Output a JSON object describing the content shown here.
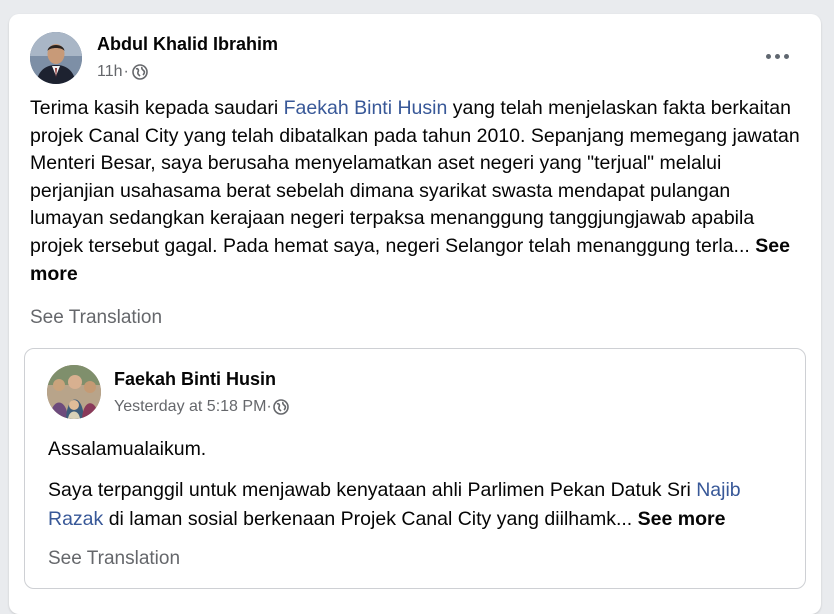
{
  "post": {
    "author": "Abdul Khalid Ibrahim",
    "time": "11h",
    "time_sep": "·",
    "privacy_icon": "globe-icon",
    "more_icon": "more-options-icon",
    "text_before": "Terima kasih kepada saudari ",
    "text_link": "Faekah Binti Husin",
    "text_after": " yang telah menjelaskan fakta berkaitan projek Canal City yang telah dibatalkan pada tahun 2010. Sepanjang memegang jawatan Menteri Besar, saya berusaha menyelamatkan aset negeri yang \"terjual\" melalui perjanjian usahasama berat sebelah dimana syarikat swasta mendapat pulangan lumayan sedangkan kerajaan negeri terpaksa menanggung tanggjungjawab apabila projek tersebut gagal. Pada  hemat saya, negeri Selangor telah menanggung terla...",
    "see_more": "See more",
    "see_translation": "See Translation"
  },
  "shared": {
    "author": "Faekah Binti Husin",
    "time": "Yesterday at 5:18 PM",
    "time_sep": "·",
    "privacy_icon": "globe-icon",
    "greeting": "Assalamualaikum.",
    "text_before": "Saya terpanggil untuk menjawab kenyataan ahli Parlimen Pekan Datuk Sri ",
    "text_link": "Najib Razak",
    "text_after": "  di laman sosial berkenaan Projek Canal City yang diilhamk...",
    "see_more": "See more",
    "see_translation": "See Translation"
  },
  "colors": {
    "link": "#385898",
    "secondary_text": "#65676b",
    "background": "#e9ebee"
  }
}
